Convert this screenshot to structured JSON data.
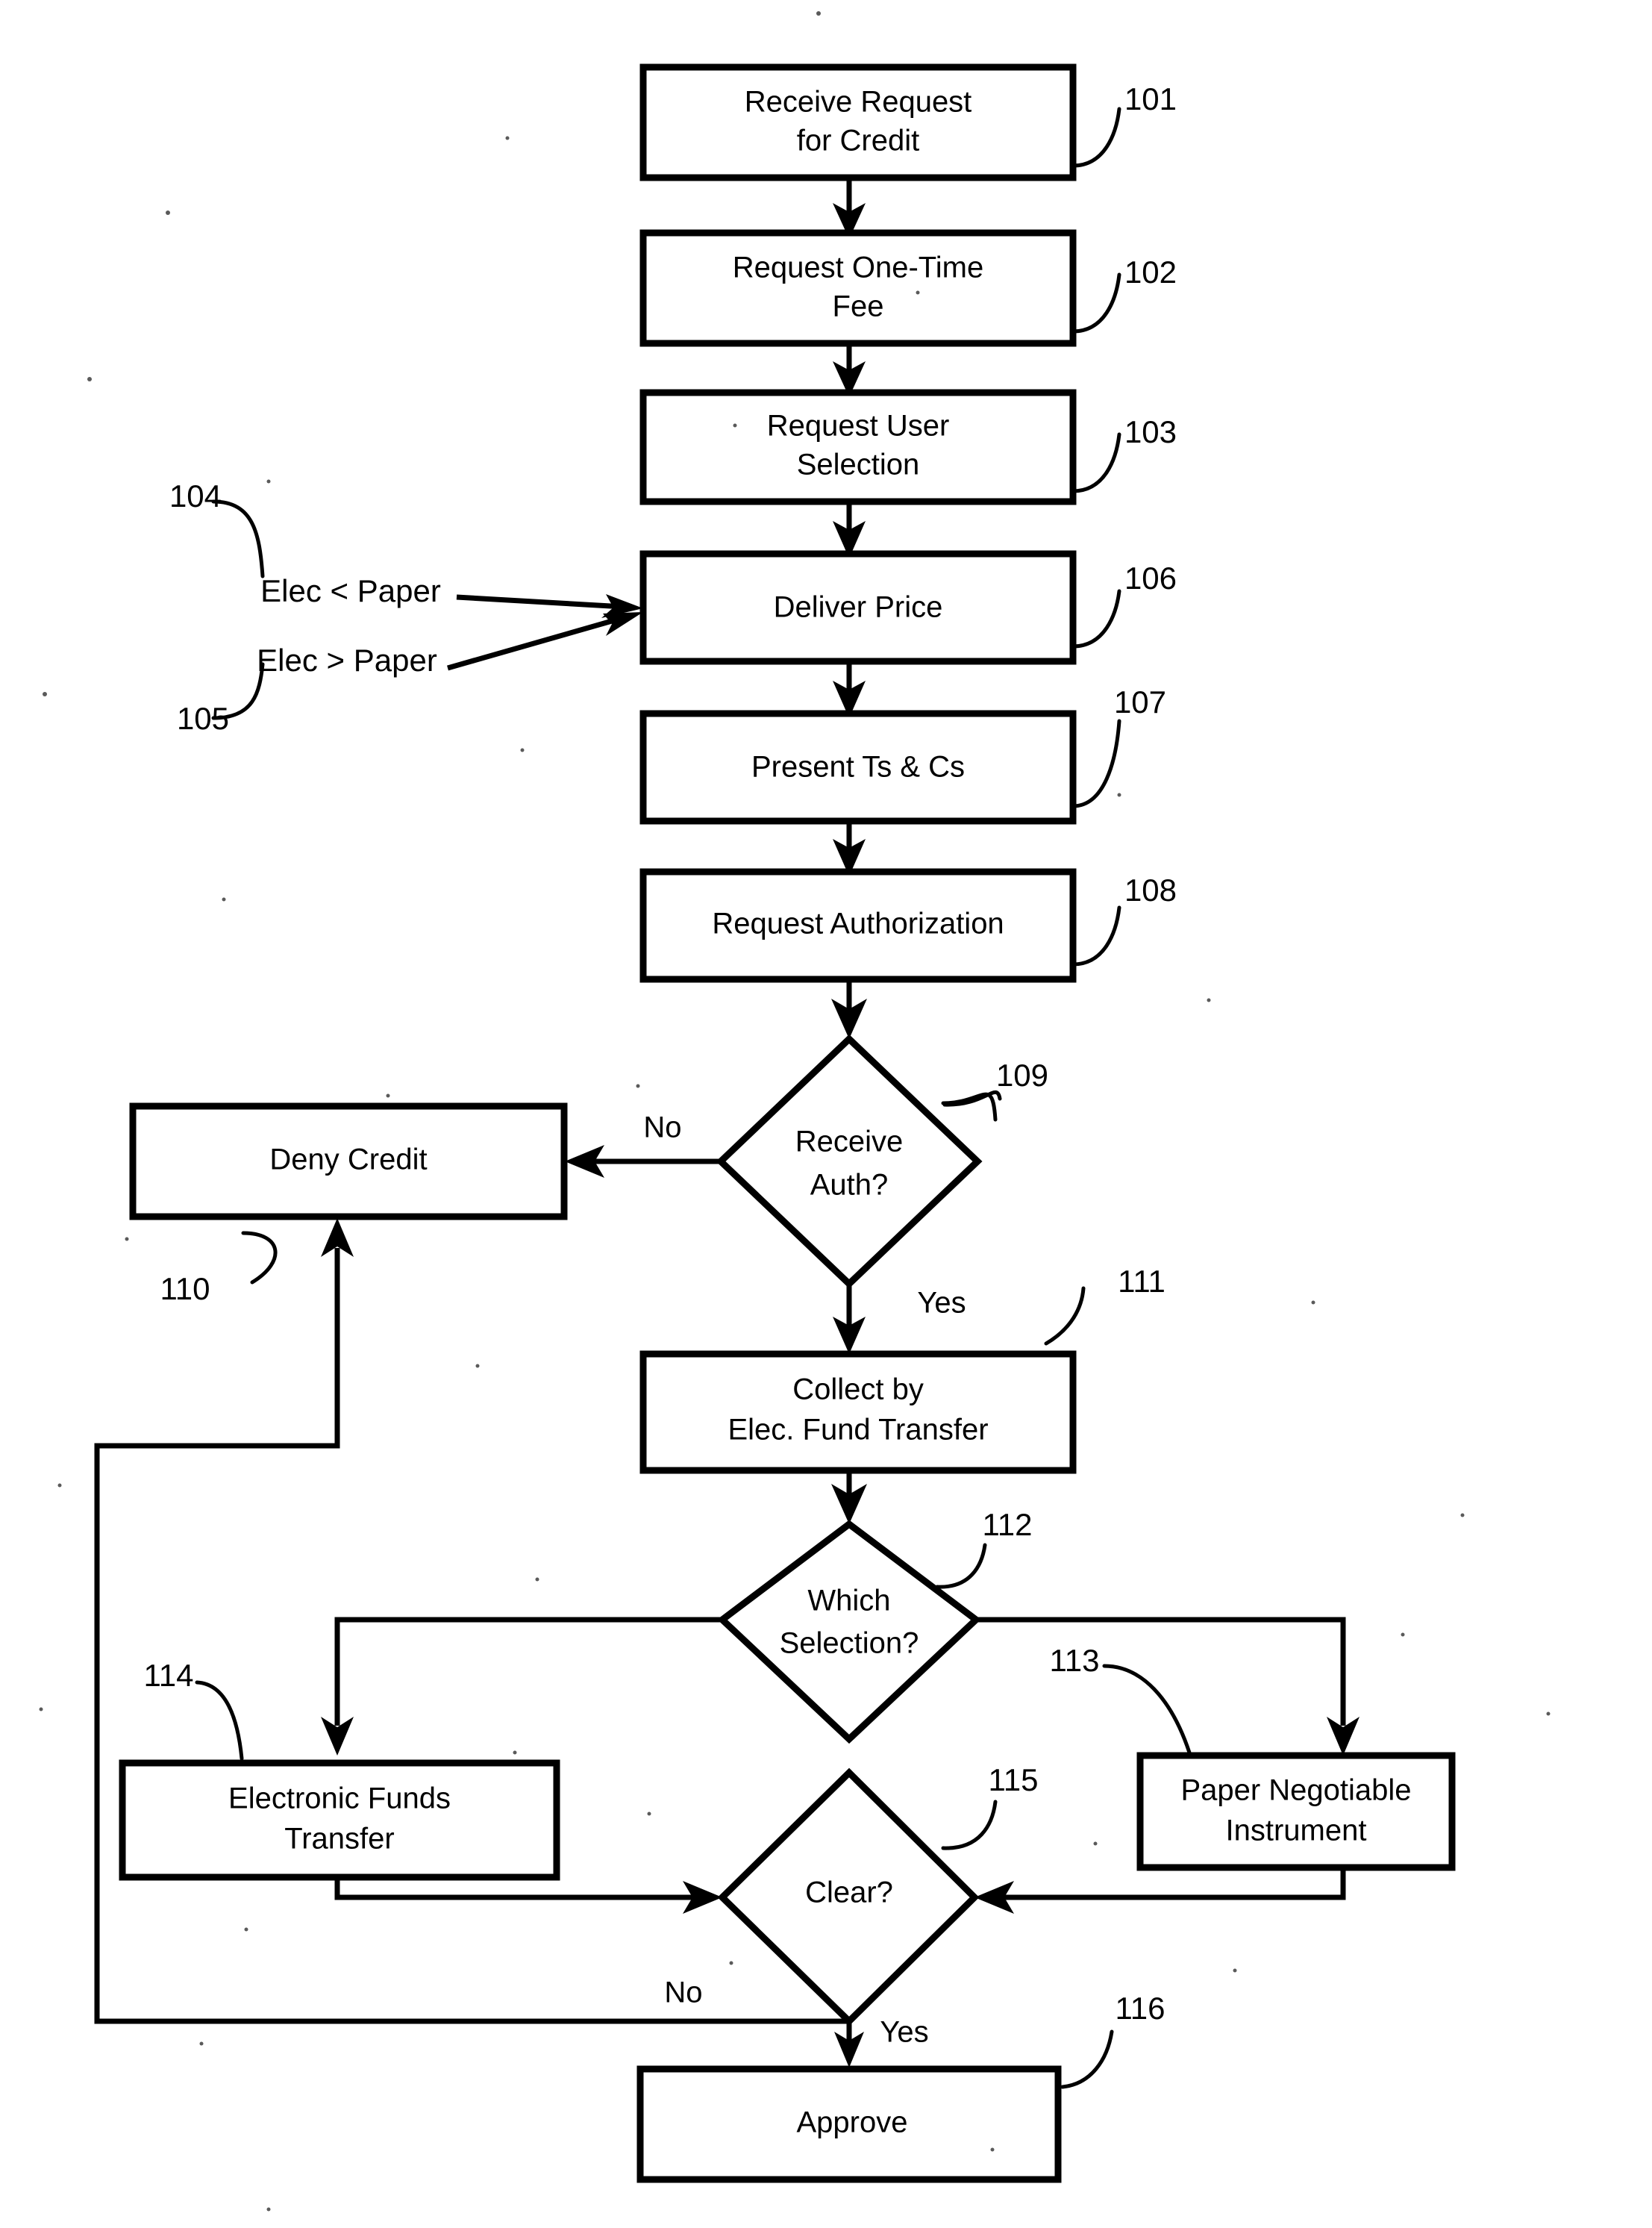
{
  "figure": {
    "type": "patent-flowchart",
    "background_color": "#ffffff",
    "ink_color": "#000000"
  },
  "nodes": [
    {
      "id": "n101",
      "shape": "rectangle",
      "ref": "101",
      "line1": "Receive Request",
      "line2": "for Credit"
    },
    {
      "id": "n102",
      "shape": "rectangle",
      "ref": "102",
      "line1": "Request One-Time",
      "line2": "Fee"
    },
    {
      "id": "n103",
      "shape": "rectangle",
      "ref": "103",
      "line1": "Request User",
      "line2": "Selection"
    },
    {
      "id": "n106",
      "shape": "rectangle",
      "ref": "106",
      "line1": "Deliver Price",
      "line2": ""
    },
    {
      "id": "n107",
      "shape": "rectangle",
      "ref": "107",
      "line1": "Present Ts & Cs",
      "line2": ""
    },
    {
      "id": "n108",
      "shape": "rectangle",
      "ref": "108",
      "line1": "Request Authorization",
      "line2": ""
    },
    {
      "id": "n109",
      "shape": "diamond",
      "ref": "109",
      "line1": "Receive",
      "line2": "Auth?"
    },
    {
      "id": "n110",
      "shape": "rectangle",
      "ref": "110",
      "line1": "Deny Credit",
      "line2": ""
    },
    {
      "id": "n111",
      "shape": "rectangle",
      "ref": "111",
      "line1": "Collect by",
      "line2": "Elec. Fund Transfer"
    },
    {
      "id": "n112",
      "shape": "diamond",
      "ref": "112",
      "line1": "Which",
      "line2": "Selection?"
    },
    {
      "id": "n113",
      "shape": "rectangle",
      "ref": "113",
      "line1": "Paper Negotiable",
      "line2": "Instrument"
    },
    {
      "id": "n114",
      "shape": "rectangle",
      "ref": "114",
      "line1": "Electronic Funds",
      "line2": "Transfer"
    },
    {
      "id": "n115",
      "shape": "diamond",
      "ref": "115",
      "line1": "Clear?",
      "line2": ""
    },
    {
      "id": "n116",
      "shape": "rectangle",
      "ref": "116",
      "line1": "Approve",
      "line2": ""
    }
  ],
  "input_conditions": [
    {
      "id": "c104",
      "ref": "104",
      "label": "Elec < Paper"
    },
    {
      "id": "c105",
      "ref": "105",
      "label": "Elec > Paper"
    }
  ],
  "edge_labels": {
    "auth_no": "No",
    "auth_yes": "Yes",
    "clear_no": "No",
    "clear_yes": "Yes"
  },
  "reference_numerals": {
    "n101": "101",
    "n102": "102",
    "n103": "103",
    "c104": "104",
    "c105": "105",
    "n106": "106",
    "n107": "107",
    "n108": "108",
    "n109": "109",
    "n110": "110",
    "n111": "111",
    "n112": "112",
    "n113": "113",
    "n114": "114",
    "n115": "115",
    "n116": "116"
  }
}
